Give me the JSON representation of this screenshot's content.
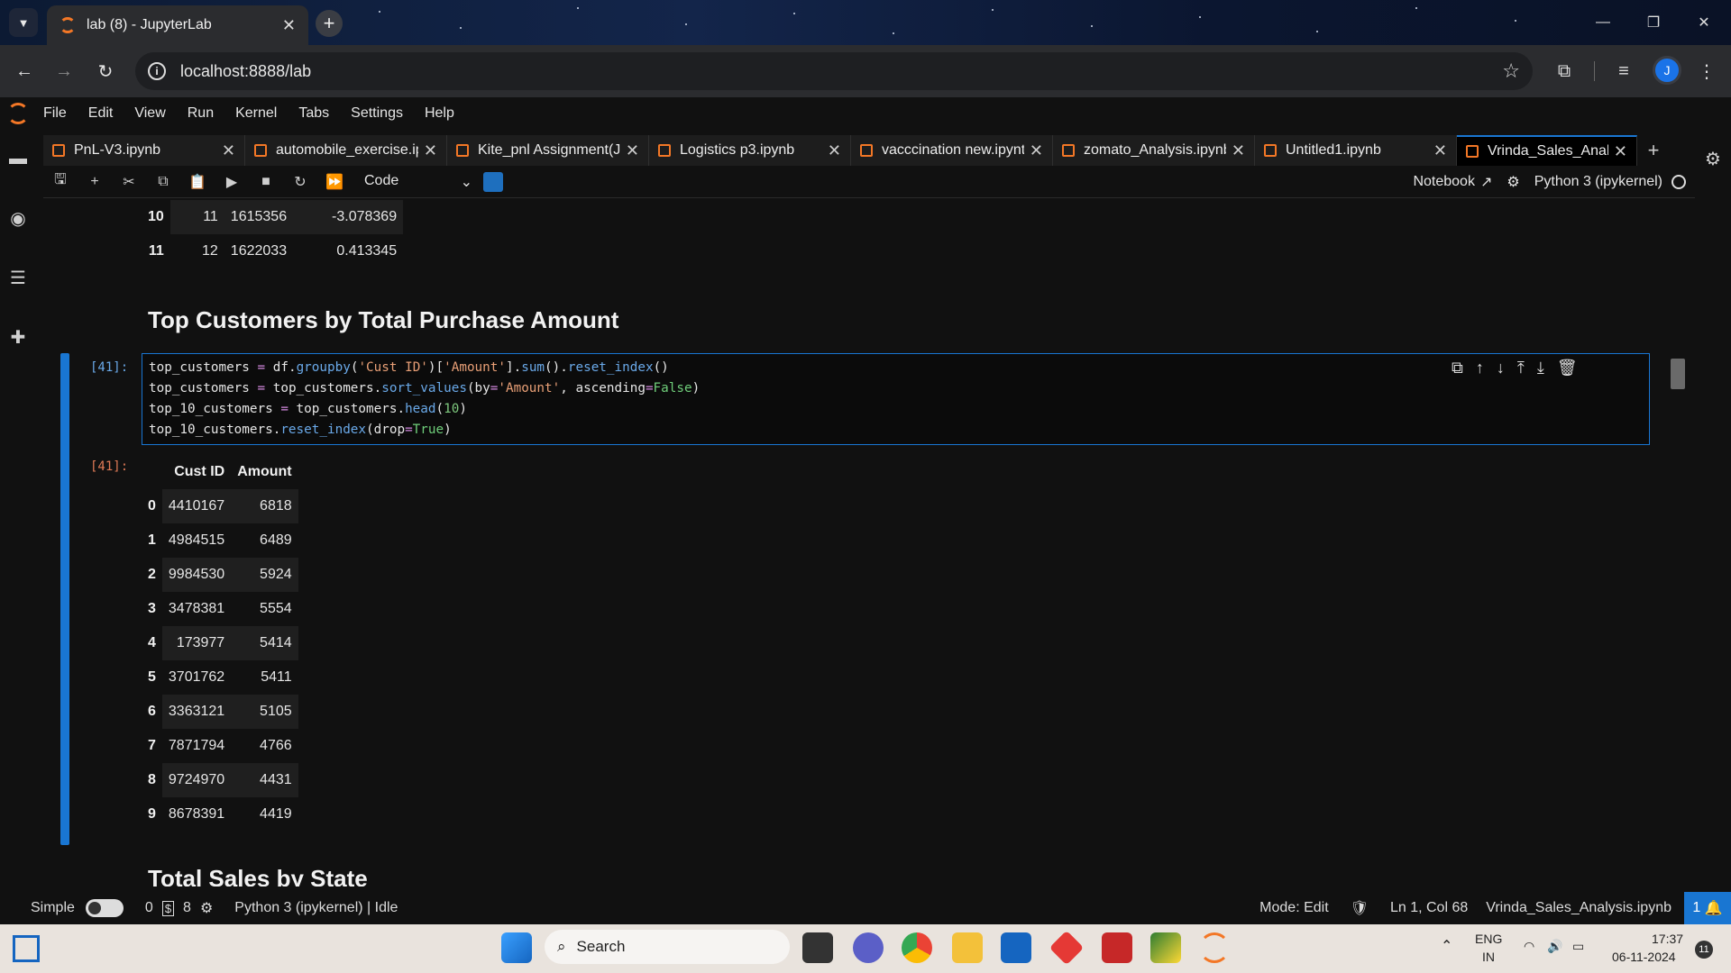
{
  "browser": {
    "tab_title": "lab (8) - JupyterLab",
    "url": "localhost:8888/lab",
    "avatar_letter": "J"
  },
  "menu": [
    "File",
    "Edit",
    "View",
    "Run",
    "Kernel",
    "Tabs",
    "Settings",
    "Help"
  ],
  "notebook_tabs": [
    {
      "label": "PnL-V3.ipynb",
      "active": false
    },
    {
      "label": "automobile_exercise.ip",
      "active": false
    },
    {
      "label": "Kite_pnl Assignment(Ja",
      "active": false
    },
    {
      "label": "Logistics p3.ipynb",
      "active": false
    },
    {
      "label": "vacccination new.ipynt",
      "active": false
    },
    {
      "label": "zomato_Analysis.ipynb",
      "active": false
    },
    {
      "label": "Untitled1.ipynb",
      "active": false
    },
    {
      "label": "Vrinda_Sales_Analysis.i",
      "active": true
    }
  ],
  "toolbar": {
    "cell_type": "Code",
    "notebook_label": "Notebook",
    "kernel_label": "Python 3 (ipykernel)"
  },
  "prev_output": {
    "rows": [
      {
        "idx": "10",
        "a": "11",
        "b": "1615356",
        "c": "-3.078369"
      },
      {
        "idx": "11",
        "a": "12",
        "b": "1622033",
        "c": "0.413345"
      }
    ]
  },
  "heading1": "Top Customers by Total Purchase Amount",
  "cell": {
    "in_prompt": "[41]:",
    "out_prompt": "[41]:"
  },
  "out_table": {
    "columns": [
      "Cust ID",
      "Amount"
    ],
    "rows": [
      {
        "idx": "0",
        "id": "4410167",
        "amt": "6818"
      },
      {
        "idx": "1",
        "id": "4984515",
        "amt": "6489"
      },
      {
        "idx": "2",
        "id": "9984530",
        "amt": "5924"
      },
      {
        "idx": "3",
        "id": "3478381",
        "amt": "5554"
      },
      {
        "idx": "4",
        "id": "173977",
        "amt": "5414"
      },
      {
        "idx": "5",
        "id": "3701762",
        "amt": "5411"
      },
      {
        "idx": "6",
        "id": "3363121",
        "amt": "5105"
      },
      {
        "idx": "7",
        "id": "7871794",
        "amt": "4766"
      },
      {
        "idx": "8",
        "id": "9724970",
        "amt": "4431"
      },
      {
        "idx": "9",
        "id": "8678391",
        "amt": "4419"
      }
    ]
  },
  "heading2": "Total Sales by State",
  "status": {
    "mode_label": "Simple",
    "count_a": "0",
    "count_b": "8",
    "kernel_state": "Python 3 (ipykernel) | Idle",
    "edit_mode": "Mode: Edit",
    "cursor": "Ln 1, Col 68",
    "filename": "Vrinda_Sales_Analysis.ipynb",
    "notif_count": "1"
  },
  "taskbar": {
    "search_placeholder": "Search",
    "lang1": "ENG",
    "lang2": "IN",
    "time": "17:37",
    "date": "06-11-2024",
    "badge": "11"
  }
}
